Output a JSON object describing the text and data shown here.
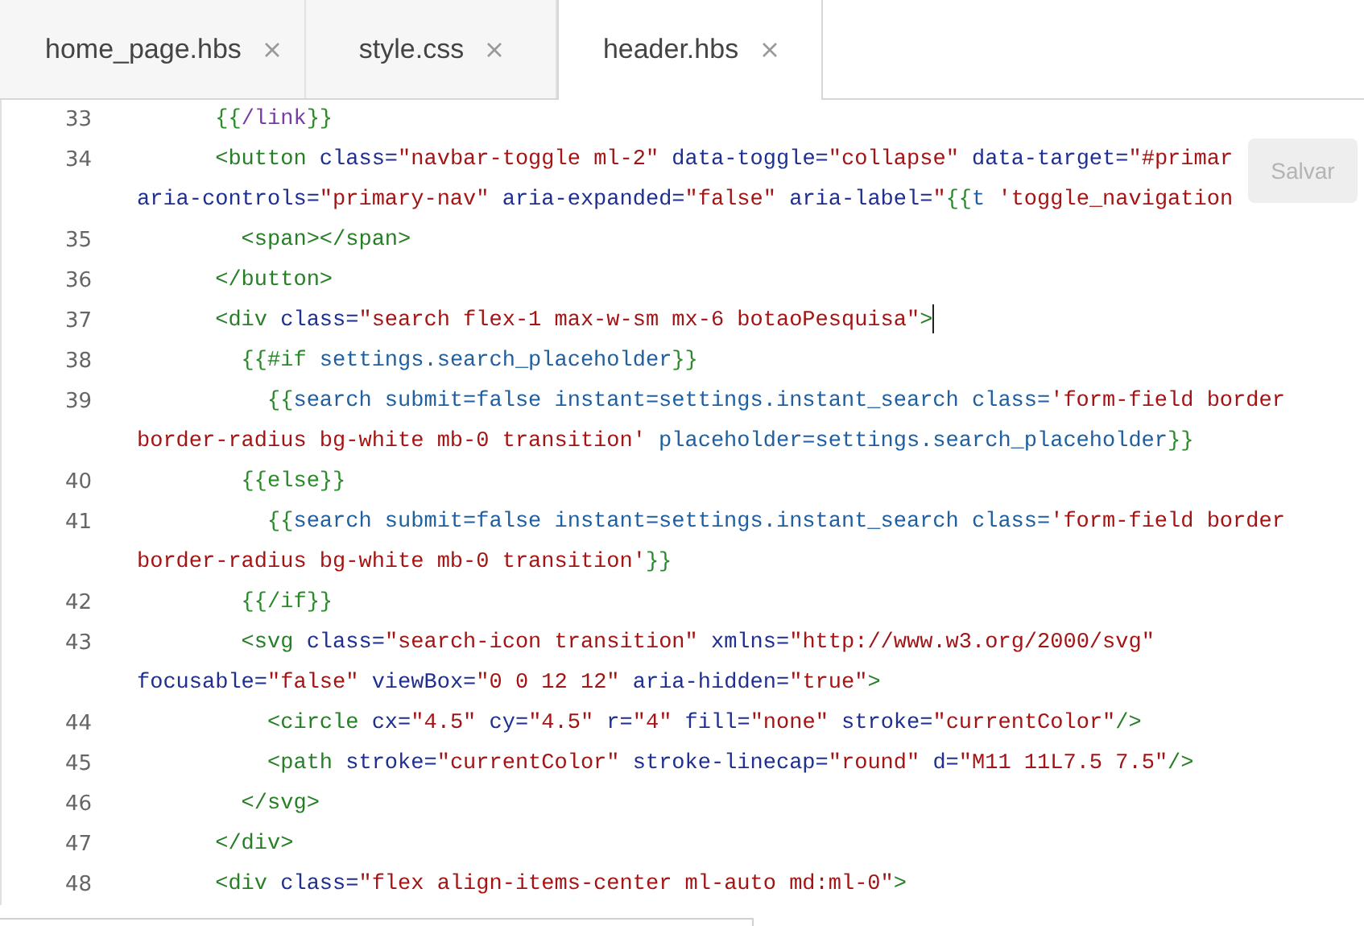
{
  "tabs": [
    {
      "label": "home_page.hbs",
      "selected": false
    },
    {
      "label": "style.css",
      "selected": false
    },
    {
      "label": "header.hbs",
      "selected": true
    }
  ],
  "save_button": {
    "label": "Salvar",
    "disabled": true
  },
  "lines": [
    {
      "number": "33",
      "rows": [
        {
          "tokens": [
            {
              "kind": "hbs",
              "text": "      {{"
            },
            {
              "kind": "kw",
              "text": "/link"
            },
            {
              "kind": "hbs",
              "text": "}}"
            }
          ]
        }
      ]
    },
    {
      "number": "34",
      "rows": [
        {
          "tokens": [
            {
              "kind": "tag",
              "text": "      <button"
            },
            {
              "kind": "attr",
              "text": " class="
            },
            {
              "kind": "str",
              "text": "\"navbar-toggle ml-2\""
            },
            {
              "kind": "attr",
              "text": " data-toggle="
            },
            {
              "kind": "str",
              "text": "\"collapse\""
            },
            {
              "kind": "attr",
              "text": " data-target="
            },
            {
              "kind": "str",
              "text": "\"#primar"
            }
          ]
        },
        {
          "tokens": [
            {
              "kind": "attr",
              "text": "aria-controls="
            },
            {
              "kind": "str",
              "text": "\"primary-nav\""
            },
            {
              "kind": "attr",
              "text": " aria-expanded="
            },
            {
              "kind": "str",
              "text": "\"false\""
            },
            {
              "kind": "attr",
              "text": " aria-label="
            },
            {
              "kind": "str",
              "text": "\""
            },
            {
              "kind": "hbs",
              "text": "{{"
            },
            {
              "kind": "name",
              "text": "t "
            },
            {
              "kind": "str",
              "text": "'toggle_navigation"
            }
          ]
        }
      ]
    },
    {
      "number": "35",
      "rows": [
        {
          "tokens": [
            {
              "kind": "tag",
              "text": "        <span></span>"
            }
          ]
        }
      ]
    },
    {
      "number": "36",
      "rows": [
        {
          "tokens": [
            {
              "kind": "tag",
              "text": "      </button>"
            }
          ]
        }
      ]
    },
    {
      "number": "37",
      "cursor": true,
      "rows": [
        {
          "tokens": [
            {
              "kind": "tag",
              "text": "      <div"
            },
            {
              "kind": "attr",
              "text": " class="
            },
            {
              "kind": "str",
              "text": "\"search flex-1 max-w-sm mx-6 botaoPesquisa\""
            },
            {
              "kind": "tag",
              "text": ">"
            }
          ]
        }
      ]
    },
    {
      "number": "38",
      "rows": [
        {
          "tokens": [
            {
              "kind": "hbs",
              "text": "        {{#if"
            },
            {
              "kind": "name",
              "text": " settings.search_placeholder"
            },
            {
              "kind": "hbs",
              "text": "}}"
            }
          ]
        }
      ]
    },
    {
      "number": "39",
      "rows": [
        {
          "tokens": [
            {
              "kind": "hbs",
              "text": "          {{"
            },
            {
              "kind": "name",
              "text": "search submit=false instant=settings.instant_search class="
            },
            {
              "kind": "str",
              "text": "'form-field border"
            }
          ]
        },
        {
          "tokens": [
            {
              "kind": "str",
              "text": "border-radius bg-white mb-0 transition'"
            },
            {
              "kind": "name",
              "text": " placeholder=settings.search_placeholder"
            },
            {
              "kind": "hbs",
              "text": "}}"
            }
          ]
        }
      ]
    },
    {
      "number": "40",
      "rows": [
        {
          "tokens": [
            {
              "kind": "hbs",
              "text": "        {{else}}"
            }
          ]
        }
      ]
    },
    {
      "number": "41",
      "rows": [
        {
          "tokens": [
            {
              "kind": "hbs",
              "text": "          {{"
            },
            {
              "kind": "name",
              "text": "search submit=false instant=settings.instant_search class="
            },
            {
              "kind": "str",
              "text": "'form-field border"
            }
          ]
        },
        {
          "tokens": [
            {
              "kind": "str",
              "text": "border-radius bg-white mb-0 transition'"
            },
            {
              "kind": "hbs",
              "text": "}}"
            }
          ]
        }
      ]
    },
    {
      "number": "42",
      "rows": [
        {
          "tokens": [
            {
              "kind": "hbs",
              "text": "        {{/if}}"
            }
          ]
        }
      ]
    },
    {
      "number": "43",
      "rows": [
        {
          "tokens": [
            {
              "kind": "tag",
              "text": "        <svg"
            },
            {
              "kind": "attr",
              "text": " class="
            },
            {
              "kind": "str",
              "text": "\"search-icon transition\""
            },
            {
              "kind": "attr",
              "text": " xmlns="
            },
            {
              "kind": "str",
              "text": "\"http://www.w3.org/2000/svg\""
            }
          ]
        },
        {
          "tokens": [
            {
              "kind": "attr",
              "text": "focusable="
            },
            {
              "kind": "str",
              "text": "\"false\""
            },
            {
              "kind": "attr",
              "text": " viewBox="
            },
            {
              "kind": "str",
              "text": "\"0 0 12 12\""
            },
            {
              "kind": "attr",
              "text": " aria-hidden="
            },
            {
              "kind": "str",
              "text": "\"true\""
            },
            {
              "kind": "tag",
              "text": ">"
            }
          ]
        }
      ]
    },
    {
      "number": "44",
      "rows": [
        {
          "tokens": [
            {
              "kind": "tag",
              "text": "          <circle"
            },
            {
              "kind": "attr",
              "text": " cx="
            },
            {
              "kind": "str",
              "text": "\"4.5\""
            },
            {
              "kind": "attr",
              "text": " cy="
            },
            {
              "kind": "str",
              "text": "\"4.5\""
            },
            {
              "kind": "attr",
              "text": " r="
            },
            {
              "kind": "str",
              "text": "\"4\""
            },
            {
              "kind": "attr",
              "text": " fill="
            },
            {
              "kind": "str",
              "text": "\"none\""
            },
            {
              "kind": "attr",
              "text": " stroke="
            },
            {
              "kind": "str",
              "text": "\"currentColor\""
            },
            {
              "kind": "tag",
              "text": "/>"
            }
          ]
        }
      ]
    },
    {
      "number": "45",
      "rows": [
        {
          "tokens": [
            {
              "kind": "tag",
              "text": "          <path"
            },
            {
              "kind": "attr",
              "text": " stroke="
            },
            {
              "kind": "str",
              "text": "\"currentColor\""
            },
            {
              "kind": "attr",
              "text": " stroke-linecap="
            },
            {
              "kind": "str",
              "text": "\"round\""
            },
            {
              "kind": "attr",
              "text": " d="
            },
            {
              "kind": "str",
              "text": "\"M11 11L7.5 7.5\""
            },
            {
              "kind": "tag",
              "text": "/>"
            }
          ]
        }
      ]
    },
    {
      "number": "46",
      "rows": [
        {
          "tokens": [
            {
              "kind": "tag",
              "text": "        </svg>"
            }
          ]
        }
      ]
    },
    {
      "number": "47",
      "rows": [
        {
          "tokens": [
            {
              "kind": "tag",
              "text": "      </div>"
            }
          ]
        }
      ]
    },
    {
      "number": "48",
      "rows": [
        {
          "tokens": [
            {
              "kind": "tag",
              "text": "      <div"
            },
            {
              "kind": "attr",
              "text": " class="
            },
            {
              "kind": "str",
              "text": "\"flex align-items-center ml-auto md:ml-0\""
            },
            {
              "kind": "tag",
              "text": ">"
            }
          ]
        }
      ]
    }
  ]
}
